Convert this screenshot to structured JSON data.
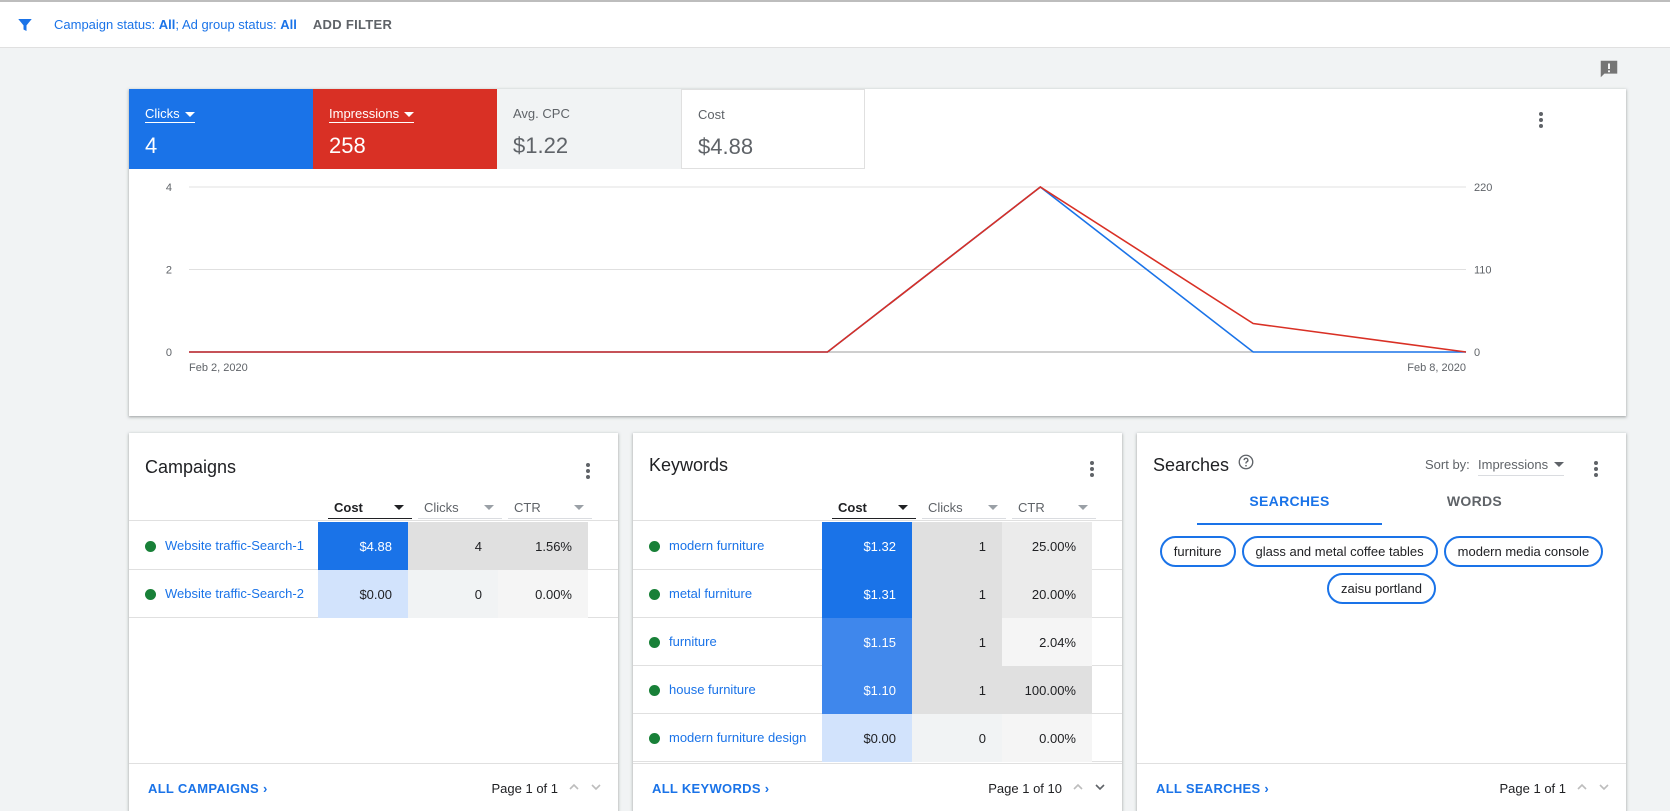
{
  "filters": {
    "campaign_status_label": "Campaign status:",
    "campaign_status_value": "All",
    "ad_group_status_label": "Ad group status:",
    "ad_group_status_value": "All",
    "add_filter": "ADD FILTER"
  },
  "metrics": [
    {
      "label": "Clicks",
      "value": "4"
    },
    {
      "label": "Impressions",
      "value": "258"
    },
    {
      "label": "Avg. CPC",
      "value": "$1.22"
    },
    {
      "label": "Cost",
      "value": "$4.88"
    }
  ],
  "colors": {
    "clicks": "#1a73e8",
    "impressions": "#d93025",
    "accent": "#1a73e8",
    "status_green": "#188038"
  },
  "chart_data": {
    "type": "line",
    "x": [
      "Feb 2, 2020",
      "Feb 3, 2020",
      "Feb 4, 2020",
      "Feb 5, 2020",
      "Feb 6, 2020",
      "Feb 7, 2020",
      "Feb 8, 2020"
    ],
    "x_tick_labels": [
      "Feb 2, 2020",
      "Feb 8, 2020"
    ],
    "series": [
      {
        "name": "Clicks",
        "axis": "left",
        "color": "#1a73e8",
        "values": [
          0,
          0,
          0,
          0,
          4,
          0,
          0
        ]
      },
      {
        "name": "Impressions",
        "axis": "right",
        "color": "#d93025",
        "values": [
          0,
          0,
          0,
          0,
          220,
          38,
          0
        ]
      }
    ],
    "y_left_ticks": [
      "0",
      "2",
      "4"
    ],
    "y_left_range": [
      0,
      4
    ],
    "y_right_ticks": [
      "0",
      "110",
      "220"
    ],
    "y_right_range": [
      0,
      220
    ],
    "grid": true
  },
  "campaigns": {
    "title": "Campaigns",
    "columns": [
      "Cost",
      "Clicks",
      "CTR"
    ],
    "rows": [
      {
        "name": "Website traffic-Search-1",
        "cost": "$4.88",
        "clicks": "4",
        "ctr": "1.56%"
      },
      {
        "name": "Website traffic-Search-2",
        "cost": "$0.00",
        "clicks": "0",
        "ctr": "0.00%"
      }
    ],
    "all_link": "ALL CAMPAIGNS",
    "pager": "Page 1 of 1"
  },
  "keywords": {
    "title": "Keywords",
    "columns": [
      "Cost",
      "Clicks",
      "CTR"
    ],
    "rows": [
      {
        "name": "modern furniture",
        "cost": "$1.32",
        "clicks": "1",
        "ctr": "25.00%"
      },
      {
        "name": "metal furniture",
        "cost": "$1.31",
        "clicks": "1",
        "ctr": "20.00%"
      },
      {
        "name": "furniture",
        "cost": "$1.15",
        "clicks": "1",
        "ctr": "2.04%"
      },
      {
        "name": "house furniture",
        "cost": "$1.10",
        "clicks": "1",
        "ctr": "100.00%"
      },
      {
        "name": "modern furniture design",
        "cost": "$0.00",
        "clicks": "0",
        "ctr": "0.00%"
      }
    ],
    "all_link": "ALL KEYWORDS",
    "pager": "Page 1 of 10"
  },
  "searches": {
    "title": "Searches",
    "sort_by_label": "Sort by:",
    "sort_by_value": "Impressions",
    "tabs": [
      "SEARCHES",
      "WORDS"
    ],
    "chips": [
      "furniture",
      "glass and metal coffee tables",
      "modern media console",
      "zaisu portland"
    ],
    "all_link": "ALL SEARCHES",
    "pager": "Page 1 of 1"
  }
}
